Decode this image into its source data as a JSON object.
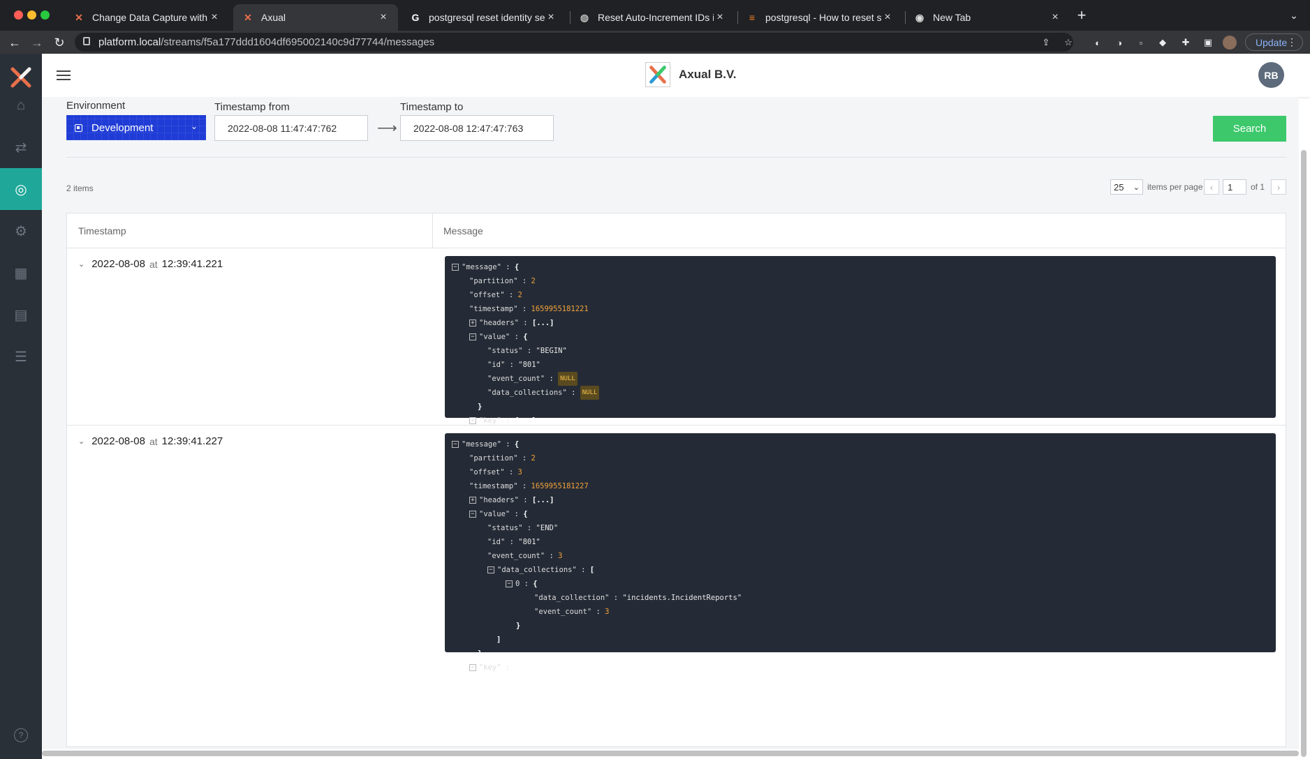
{
  "browser": {
    "tabs": [
      {
        "title": "Change Data Capture with Pos",
        "icon": "axual-logo-icon",
        "active": false
      },
      {
        "title": "Axual",
        "icon": "axual-logo-icon",
        "active": true
      },
      {
        "title": "postgresql reset identity seque",
        "icon": "google-icon",
        "active": false
      },
      {
        "title": "Reset Auto-Increment IDs in Po",
        "icon": "globe-icon",
        "active": false
      },
      {
        "title": "postgresql - How to reset sequ",
        "icon": "stackoverflow-icon",
        "active": false
      },
      {
        "title": "New Tab",
        "icon": "chrome-icon",
        "active": false
      }
    ],
    "url_host": "platform.local",
    "url_path": "/streams/f5a177ddd1604df695002140c9d77744/messages",
    "update_label": "Update"
  },
  "header": {
    "brand_name": "Axual B.V.",
    "avatar_initials": "RB"
  },
  "filters": {
    "environment_label": "Environment",
    "environment_value": "Development",
    "timestamp_from_label": "Timestamp from",
    "timestamp_from_value": "2022-08-08 11:47:47:762",
    "timestamp_to_label": "Timestamp to",
    "timestamp_to_value": "2022-08-08 12:47:47:763",
    "search_label": "Search"
  },
  "pagination": {
    "items_count": "2 items",
    "per_page_value": "25",
    "per_page_label": "items per page",
    "page_value": "1",
    "page_of": "of 1"
  },
  "table": {
    "col_timestamp": "Timestamp",
    "col_message": "Message",
    "rows": [
      {
        "date": "2022-08-08",
        "at": "at",
        "time": "12:39:41.221"
      },
      {
        "date": "2022-08-08",
        "at": "at",
        "time": "12:39:41.227"
      }
    ]
  },
  "messages": [
    {
      "partition": "2",
      "offset": "2",
      "timestamp": "1659955181221",
      "status": "\"BEGIN\"",
      "id": "\"801\"",
      "event_count": "NULL",
      "data_collections": "NULL"
    },
    {
      "partition": "2",
      "offset": "3",
      "timestamp": "1659955181227",
      "status": "\"END\"",
      "id": "\"801\"",
      "event_count": "3",
      "data_collection": "\"incidents.IncidentReports\"",
      "dc_event_count": "3"
    }
  ],
  "json_keys": {
    "message": "\"message\"",
    "partition": "\"partition\"",
    "offset": "\"offset\"",
    "timestamp": "\"timestamp\"",
    "headers": "\"headers\"",
    "value": "\"value\"",
    "status": "\"status\"",
    "id": "\"id\"",
    "event_count": "\"event_count\"",
    "data_collections": "\"data_collections\"",
    "data_collection": "\"data_collection\"",
    "key": "\"key\"",
    "index0": "0",
    "collapsed_arr": "[...]",
    "collapsed_obj": "{...}"
  },
  "colors": {
    "sidebar": "#2a3038",
    "active_nav": "#1fa899",
    "env_select": "#1f3cd6",
    "search_button": "#3cc86b",
    "json_bg": "#252b36",
    "json_number": "#f4a33a"
  }
}
